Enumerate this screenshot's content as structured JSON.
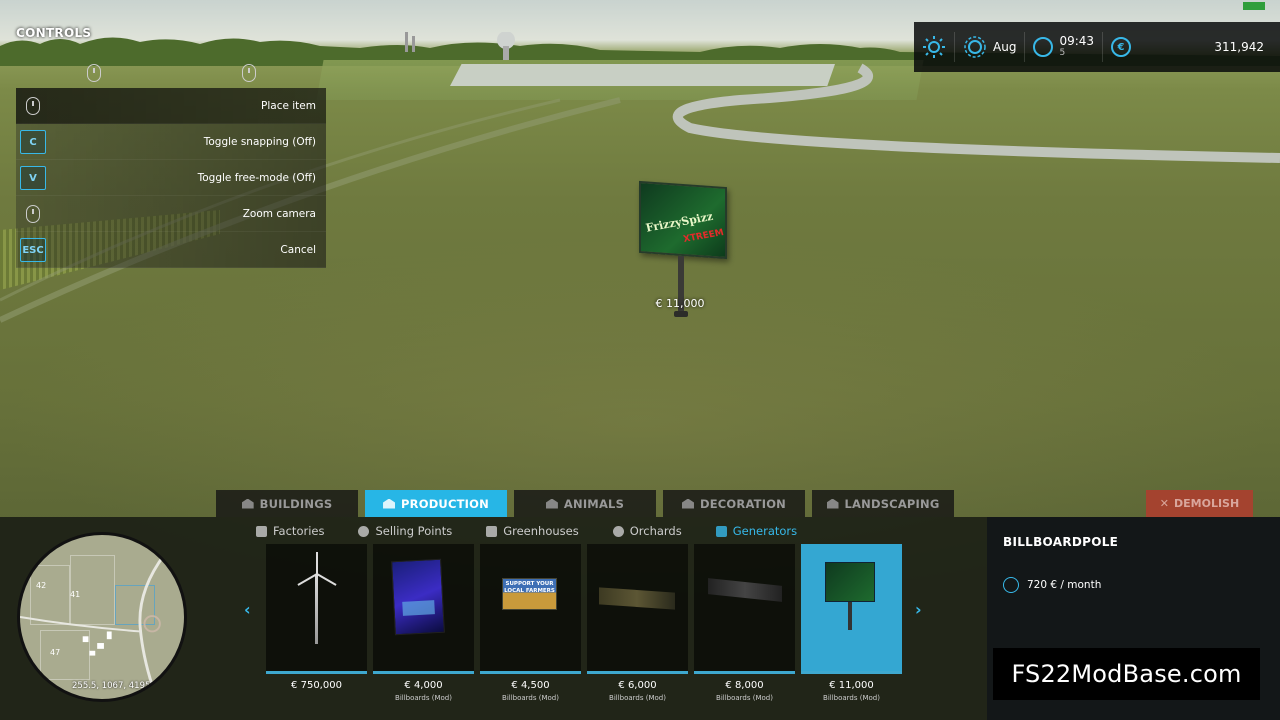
{
  "world": {
    "billboard_text_1": "FrizzySpizz",
    "billboard_text_2": "XTREEM",
    "placement_price": "€ 11,000"
  },
  "controls": {
    "title": "CONTROLS",
    "rows": [
      {
        "key": "",
        "icon": "mouse-left-icon",
        "label": "Place item"
      },
      {
        "key": "C",
        "label": "Toggle snapping (Off)"
      },
      {
        "key": "V",
        "label": "Toggle free-mode (Off)"
      },
      {
        "key": "",
        "icon": "mouse-wheel-icon",
        "label": "Zoom camera"
      },
      {
        "key": "ESC",
        "label": "Cancel"
      }
    ]
  },
  "hud": {
    "month": "Aug",
    "time": "09:43",
    "speed": "5",
    "money": "311,942"
  },
  "tabs": [
    {
      "label": "BUILDINGS",
      "active": false
    },
    {
      "label": "PRODUCTION",
      "active": true
    },
    {
      "label": "ANIMALS",
      "active": false
    },
    {
      "label": "DECORATION",
      "active": false
    },
    {
      "label": "LANDSCAPING",
      "active": false
    }
  ],
  "demolish_label": "DEMOLISH",
  "subtabs": [
    {
      "label": "Factories",
      "active": false
    },
    {
      "label": "Selling Points",
      "active": false
    },
    {
      "label": "Greenhouses",
      "active": false
    },
    {
      "label": "Orchards",
      "active": false
    },
    {
      "label": "Generators",
      "active": true
    }
  ],
  "items": [
    {
      "price": "€ 750,000",
      "sub": ""
    },
    {
      "price": "€ 4,000",
      "sub": "Billboards (Mod)"
    },
    {
      "price": "€ 4,500",
      "sub": "Billboards (Mod)"
    },
    {
      "price": "€ 6,000",
      "sub": "Billboards (Mod)"
    },
    {
      "price": "€ 8,000",
      "sub": "Billboards (Mod)"
    },
    {
      "price": "€ 11,000",
      "sub": "Billboards (Mod)"
    }
  ],
  "item_art": {
    "farmers_sign": "SUPPORT YOUR LOCAL FARMERS"
  },
  "info": {
    "title": "BILLBOARDPOLE",
    "cost": "720 € / month"
  },
  "minimap": {
    "labels": [
      "42",
      "41",
      "47"
    ],
    "coords": "255.5, 1067, 4195"
  },
  "watermark": "FS22ModBase.com",
  "colors": {
    "accent": "#27b6e6",
    "demolish": "#a4432f"
  }
}
